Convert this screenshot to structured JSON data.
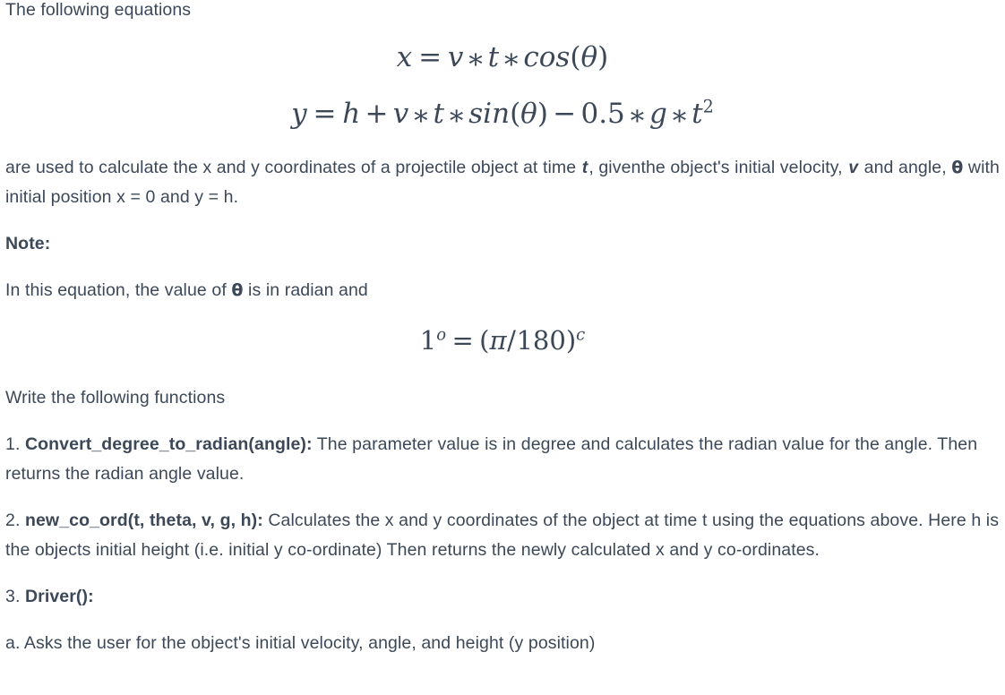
{
  "intro": {
    "lead": "The following equations"
  },
  "equations": {
    "eq_x": {
      "lhs": "x",
      "eq": "=",
      "terms": [
        "v",
        "t",
        "cos"
      ],
      "arg": "θ",
      "plain": "x = v * t * cos(θ)"
    },
    "eq_y": {
      "lhs": "y",
      "eq": "=",
      "h": "h",
      "plus": "+",
      "v": "v",
      "t": "t",
      "fn": "sin",
      "arg": "θ",
      "minus": "−",
      "coef": "0.5",
      "g": "g",
      "t2_base": "t",
      "t2_exp": "2",
      "ast": "∗",
      "plain": "y = h + v * t * sin(θ) − 0.5 * g * t²"
    },
    "eq_radian": {
      "one": "1",
      "deg_sup": "o",
      "eq": "=",
      "lparen": "(",
      "pi": "π",
      "slash": "/",
      "num": "180",
      "rparen": ")",
      "rad_sup": "c",
      "plain": "1º = (π/180)ᶜ"
    }
  },
  "paragraphs": {
    "usage_line1_a": "are used to calculate the x and y coordinates of a projectile object at time ",
    "usage_line1_var": "t",
    "usage_line1_b": ", given",
    "usage_line2_a": "the object's initial velocity, ",
    "usage_line2_var_v": "v",
    "usage_line2_b": " and angle, ",
    "usage_line2_var_theta": "θ",
    "usage_line2_c": " with initial position x = 0 and y = h.",
    "note_heading": "Note:",
    "note_body": "In this equation, the value of ",
    "note_theta": "θ",
    "note_body_tail": " is in radian and",
    "write_functions": "Write the following functions"
  },
  "functions": [
    {
      "number": "1. ",
      "name": "Convert_degree_to_radian(angle):",
      "description": " The parameter value is in degree and calculates the radian value for the angle. Then returns the radian angle value."
    },
    {
      "number": "2. ",
      "name": "new_co_ord(t, theta, v, g, h):",
      "description": " Calculates the x and y coordinates of the object at time t using the equations above. Here h is the objects initial height (i.e. initial y co-ordinate) Then returns the newly calculated x and y co-ordinates."
    },
    {
      "number": "3. ",
      "name": "Driver():",
      "description": ""
    }
  ],
  "driver_steps": [
    {
      "label": "a. ",
      "text": "Asks the user for the object's initial velocity, angle, and height (y position)"
    }
  ],
  "colors": {
    "text": "#3c4858",
    "background": "#ffffff"
  }
}
